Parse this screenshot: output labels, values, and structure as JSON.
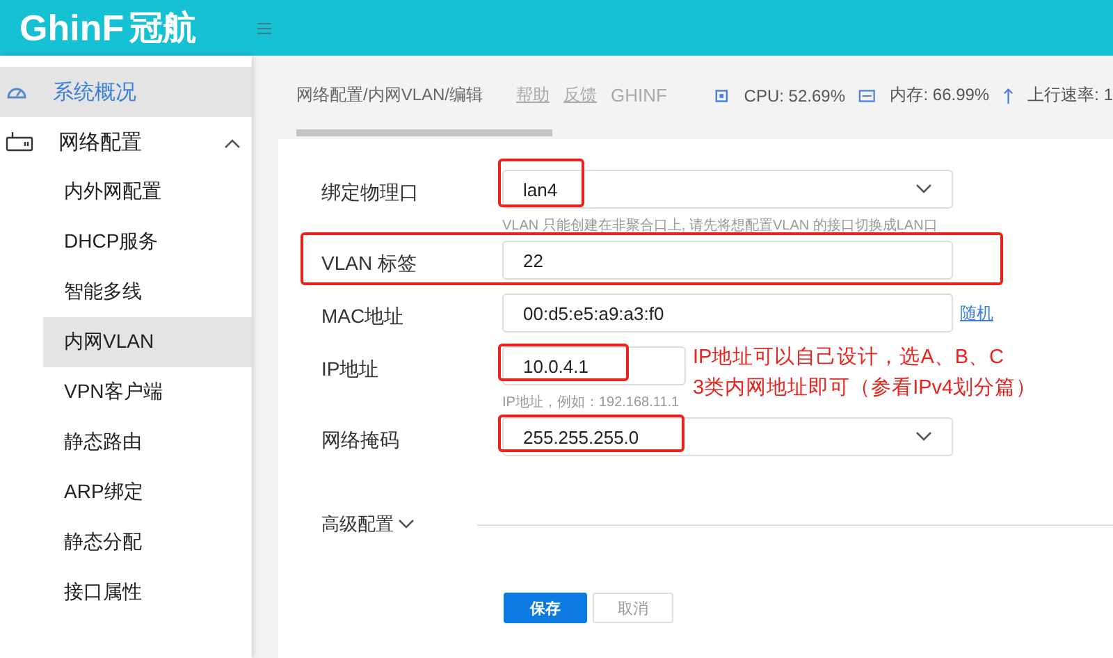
{
  "header": {
    "logo_latin": "GhinF",
    "logo_cjk": "冠航"
  },
  "sidebar": {
    "items": [
      {
        "label": "系统概况",
        "selected": true
      },
      {
        "label": "网络配置",
        "selected": false,
        "expanded": true,
        "children": [
          {
            "label": "内外网配置",
            "selected": false
          },
          {
            "label": "DHCP服务",
            "selected": false
          },
          {
            "label": "智能多线",
            "selected": false
          },
          {
            "label": "内网VLAN",
            "selected": true
          },
          {
            "label": "VPN客户端",
            "selected": false
          },
          {
            "label": "静态路由",
            "selected": false
          },
          {
            "label": "ARP绑定",
            "selected": false
          },
          {
            "label": "静态分配",
            "selected": false
          },
          {
            "label": "接口属性",
            "selected": false
          }
        ]
      }
    ]
  },
  "topbar": {
    "breadcrumb": "网络配置/内网VLAN/编辑",
    "links": [
      "帮助",
      "反馈"
    ],
    "brand": "GHINF",
    "cpu": "CPU: 52.69%",
    "memory": "内存: 66.99%",
    "upload": "上行速率: 1"
  },
  "form": {
    "rows": [
      {
        "kind": "select",
        "label": "绑定物理口",
        "value": "lan4",
        "hint": "VLAN 只能创建在非聚合口上, 请先将想配置VLAN 的接口切换成LAN口",
        "value_boxed": true,
        "row_boxed": false
      },
      {
        "kind": "input",
        "label": "VLAN 标签",
        "value": "22",
        "value_boxed": false,
        "row_boxed": true
      },
      {
        "kind": "input",
        "label": "MAC地址",
        "value": "00:d5:e5:a9:a3:f0",
        "link": "随机",
        "value_boxed": false,
        "row_boxed": false
      },
      {
        "kind": "input",
        "label": "IP地址",
        "value": "10.0.4.1",
        "hint": "IP地址，例如：192.168.11.1",
        "value_boxed": true,
        "row_boxed": false,
        "note": [
          "IP地址可以自己设计，选A、B、C",
          "3类内网地址即可（参看IPv4划分篇）"
        ]
      },
      {
        "kind": "select",
        "label": "网络掩码",
        "value": "255.255.255.0",
        "value_boxed": true,
        "row_boxed": false
      }
    ],
    "advanced": {
      "label": "高级配置",
      "expanded": false
    },
    "buttons": [
      {
        "label": "保存",
        "kind": "primary"
      },
      {
        "label": "取消",
        "kind": "secondary"
      }
    ]
  }
}
